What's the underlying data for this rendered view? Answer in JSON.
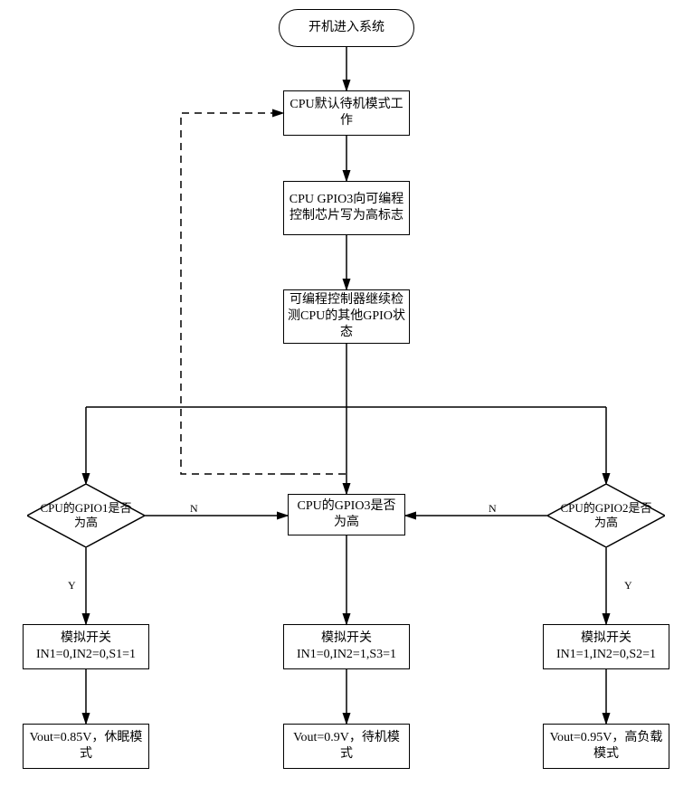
{
  "chart_data": {
    "type": "flowchart",
    "nodes": {
      "start": {
        "shape": "terminator",
        "label": "开机进入系统"
      },
      "standby": {
        "shape": "process",
        "label": "CPU默认待机模式工作"
      },
      "writeHigh": {
        "shape": "process",
        "label": "CPU GPIO3向可编程控制芯片写为高标志"
      },
      "poll": {
        "shape": "process",
        "label": "可编程控制器继续检测CPU的其他GPIO状态"
      },
      "gpio1": {
        "shape": "decision",
        "label": "CPU的GPIO1是否为高"
      },
      "gpio3": {
        "shape": "decision",
        "label": "CPU的GPIO3是否为高"
      },
      "gpio2": {
        "shape": "decision",
        "label": "CPU的GPIO2是否为高"
      },
      "sw1": {
        "shape": "process",
        "label": "模拟开关\nIN1=0,IN2=0,S1=1"
      },
      "sw3": {
        "shape": "process",
        "label": "模拟开关\nIN1=0,IN2=1,S3=1"
      },
      "sw2": {
        "shape": "process",
        "label": "模拟开关\nIN1=1,IN2=0,S2=1"
      },
      "out1": {
        "shape": "process",
        "label": "Vout=0.85V，休眠模式"
      },
      "out3": {
        "shape": "process",
        "label": "Vout=0.9V，待机模式"
      },
      "out2": {
        "shape": "process",
        "label": "Vout=0.95V，高负载模式"
      }
    },
    "edges": [
      {
        "from": "start",
        "to": "standby"
      },
      {
        "from": "standby",
        "to": "writeHigh"
      },
      {
        "from": "writeHigh",
        "to": "poll"
      },
      {
        "from": "poll",
        "to": "gpio1",
        "branch": true
      },
      {
        "from": "poll",
        "to": "gpio3",
        "branch": true
      },
      {
        "from": "poll",
        "to": "gpio2",
        "branch": true
      },
      {
        "from": "gpio1",
        "to": "sw1",
        "label": "Y"
      },
      {
        "from": "gpio1",
        "to": "gpio3",
        "label": "N"
      },
      {
        "from": "gpio2",
        "to": "sw2",
        "label": "Y"
      },
      {
        "from": "gpio2",
        "to": "gpio3",
        "label": "N"
      },
      {
        "from": "gpio3",
        "to": "sw3"
      },
      {
        "from": "sw1",
        "to": "out1"
      },
      {
        "from": "sw3",
        "to": "out3"
      },
      {
        "from": "sw2",
        "to": "out2"
      },
      {
        "from": "gpio3",
        "to": "standby",
        "style": "dashed",
        "note": "loop back"
      }
    ]
  }
}
